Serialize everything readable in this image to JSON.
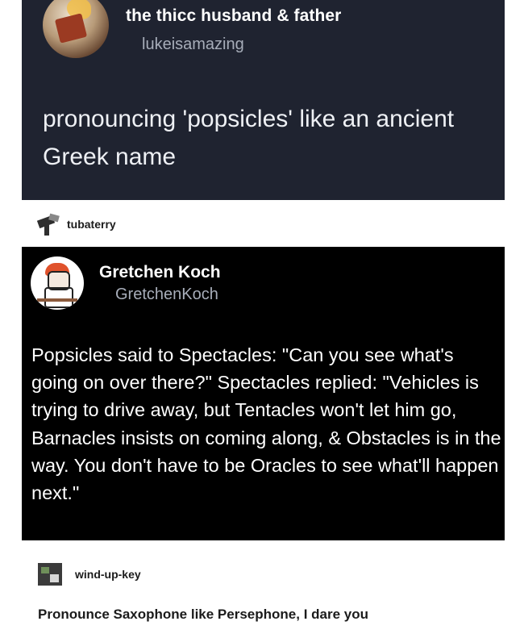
{
  "post1": {
    "display_name": "the thicc husband & father",
    "username": "lukeisamazing",
    "text": "pronouncing 'popsicles' like an ancient Greek name"
  },
  "reblog1": {
    "username": "tubaterry"
  },
  "post2": {
    "display_name": "Gretchen Koch",
    "username": "GretchenKoch",
    "text": "Popsicles said to Spectacles: \"Can you see what's going on over there?\" Spectacles replied: \"Vehicles is trying to drive away, but Tentacles won't let him go, Barnacles insists on coming along, & Obstacles is in the way. You don't have to be Oracles to see what'll happen next.\""
  },
  "reblog2": {
    "username": "wind-up-key",
    "text": "Pronounce Saxophone like Persephone, I dare you"
  },
  "colors": {
    "card1_bg": "#1f2330",
    "card2_bg": "#000000",
    "page_bg": "#ffffff"
  }
}
